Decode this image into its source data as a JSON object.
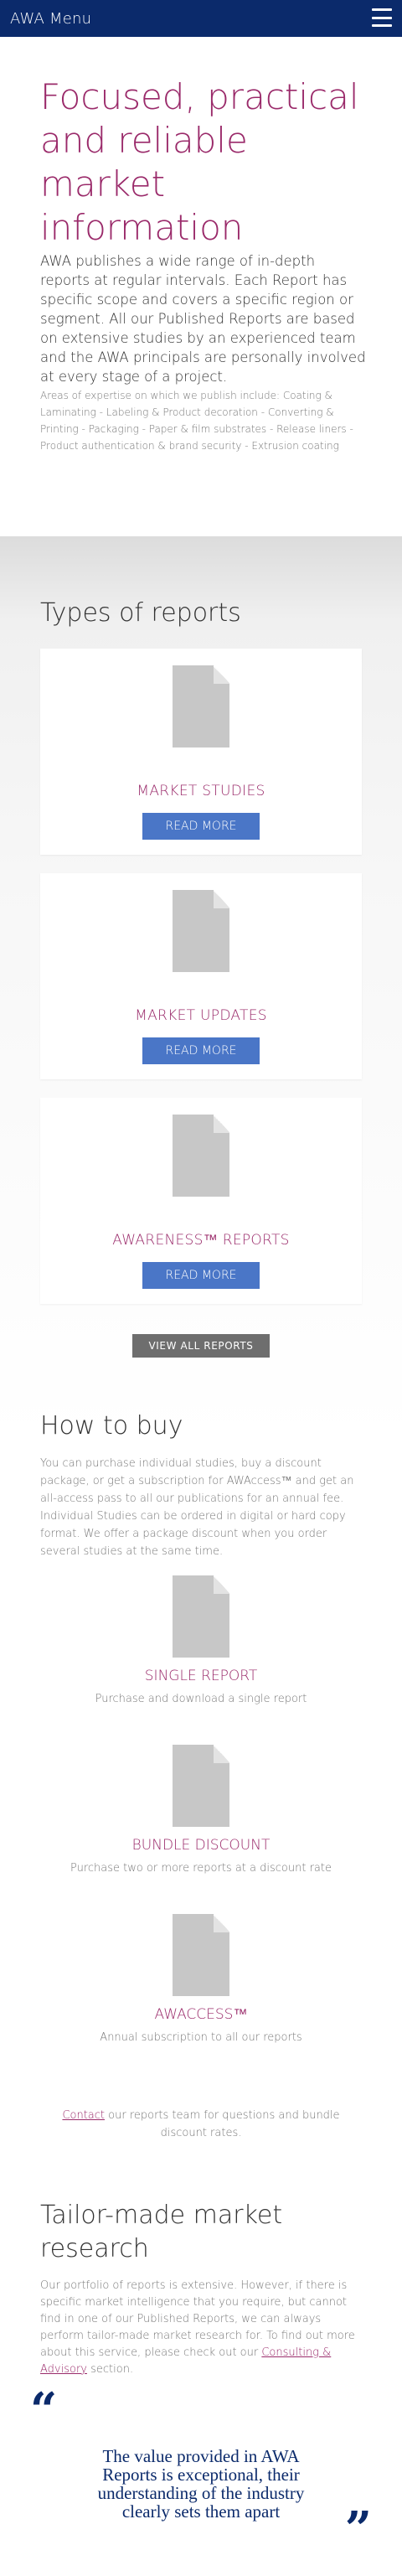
{
  "header": {
    "brand": "AWA Menu",
    "menu_icon": "hamburger-menu-icon"
  },
  "hero": {
    "title": "Focused, practical and reliable market information",
    "intro": "AWA publishes a wide range of in-depth reports at regular intervals. Each Report has specific scope and covers a specific region or segment. All our Published Reports are based on extensive studies by an experienced team and the AWA principals are personally involved at every stage of a project.",
    "areas": "Areas of expertise on which we publish include: Coating & Laminating - Labeling & Product decoration - Converting & Printing - Packaging - Paper & film substrates - Release liners - Product authentication & brand security - Extrusion coating"
  },
  "types": {
    "title": "Types of reports",
    "cards": [
      {
        "title": "MARKET STUDIES",
        "button": "READ MORE",
        "icon": "document-icon"
      },
      {
        "title": "MARKET UPDATES",
        "button": "READ MORE",
        "icon": "document-icon"
      },
      {
        "title": "AWARENESS™ REPORTS",
        "button": "READ MORE",
        "icon": "document-icon"
      }
    ],
    "view_all": "VIEW ALL REPORTS"
  },
  "how_to_buy": {
    "title": "How to buy",
    "text": "You can purchase individual studies, buy a discount package, or get a subscription for AWAccess™ and get an all-access pass to all our publications for an annual fee. Individual Studies can be ordered in digital or hard copy format. We offer a package discount when you order several studies at the same time.",
    "items": [
      {
        "title": "SINGLE REPORT",
        "desc": "Purchase and download a single report",
        "icon": "document-icon"
      },
      {
        "title": "BUNDLE DISCOUNT",
        "desc": "Purchase two or more reports at a discount rate",
        "icon": "document-icon"
      },
      {
        "title": "AWACCESS™",
        "desc": "Annual subscription to all our reports",
        "icon": "document-icon"
      }
    ],
    "contact_link": "Contact",
    "contact_rest": " our reports team for questions and bundle discount rates."
  },
  "tailor": {
    "title": "Tailor-made market research",
    "text_before": "Our portfolio of reports is extensive. However, if there is specific market intelligence that you require, but cannot find in one of our Published Reports, we can always perform tailor-made market research for. To find out more about this service, please check out our ",
    "link": "Consulting & Advisory",
    "text_after": " section."
  },
  "quote": {
    "open_mark": "“",
    "close_mark": "”",
    "text": "The value provided in AWA Reports is exceptional, their understanding of the industry clearly sets them apart"
  },
  "colors": {
    "header": "#0b2a6b",
    "accent": "#9a2a6a",
    "button": "#4a76c7",
    "view_all": "#6e6e6e"
  }
}
